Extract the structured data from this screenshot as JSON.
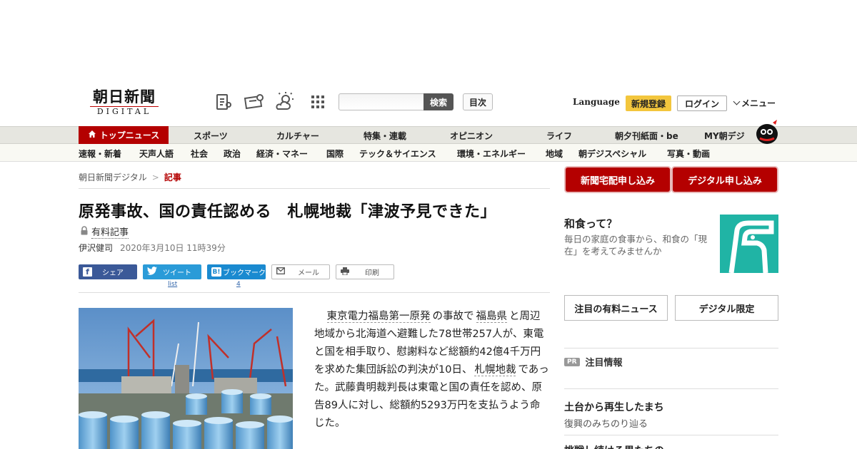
{
  "header": {
    "logo_main": "朝日新聞",
    "logo_sub": "DIGITAL",
    "search_button": "検索",
    "search_placeholder": "",
    "toc_button": "目次",
    "language": "Language",
    "signup": "新規登録",
    "login": "ログイン",
    "menu": "メニュー"
  },
  "nav_primary": [
    {
      "label": "トップニュース"
    },
    {
      "label": "スポーツ"
    },
    {
      "label": "カルチャー"
    },
    {
      "label": "特集・連載"
    },
    {
      "label": "オピニオン"
    },
    {
      "label": "ライフ"
    },
    {
      "label": "朝夕刊紙面・be"
    },
    {
      "label": "MY朝デジ"
    }
  ],
  "nav_secondary": [
    {
      "label": "速報・新着"
    },
    {
      "label": "天声人語"
    },
    {
      "label": "社会"
    },
    {
      "label": "政治"
    },
    {
      "label": "経済・マネー"
    },
    {
      "label": "国際"
    },
    {
      "label": "テック＆サイエンス"
    },
    {
      "label": "環境・エネルギー"
    },
    {
      "label": "地域"
    },
    {
      "label": "朝デジスペシャル"
    },
    {
      "label": "写真・動画"
    }
  ],
  "breadcrumb": {
    "root": "朝日新聞デジタル",
    "sep": ">",
    "current": "記事"
  },
  "article": {
    "headline": "原発事故、国の責任認める　札幌地裁「津波予見できた」",
    "paid_label": "有料記事",
    "author": "伊沢健司",
    "date": "2020年3月10日 11時39分",
    "body_link1": "東京電力福島第一原発",
    "body_seg1": "の事故で",
    "body_link2": "福島県",
    "body_seg2": "と周辺地域から北海道へ避難した78世帯257人が、東電と国を相手取り、慰謝料など総額約42億4千万円を求めた集団訴訟の判決が10日、",
    "body_link3": "札幌地裁",
    "body_seg3": "であった。武藤貴明裁判長は東電と国の責任を認め、原告89人に対し、総額約5293万円を支払うよう命じた。"
  },
  "share": {
    "facebook": "シェア",
    "twitter": "ツイート",
    "twitter_count": "list",
    "hatena": "ブックマーク",
    "hatena_count": "4",
    "mail": "メール",
    "print": "印刷"
  },
  "sidebar": {
    "btn_paper": "新聞宅配申し込み",
    "btn_digital": "デジタル申し込み",
    "promo_title": "和食って？",
    "promo_desc": "毎日の家庭の食事から、和食の「現在」を考えてみませんか",
    "box_paid": "注目の有料ニュース",
    "box_digital": "デジタル限定",
    "pr_badge": "PR",
    "pr_title": "注目情報",
    "item1_title": "土台から再生したまち",
    "item1_sub": "復興のみちのり辿る",
    "item2_title": "挑戦し続ける男たちの"
  },
  "colors": {
    "brand": "#b40000",
    "accent": "#f3c63d",
    "teal": "#20b4a5"
  }
}
